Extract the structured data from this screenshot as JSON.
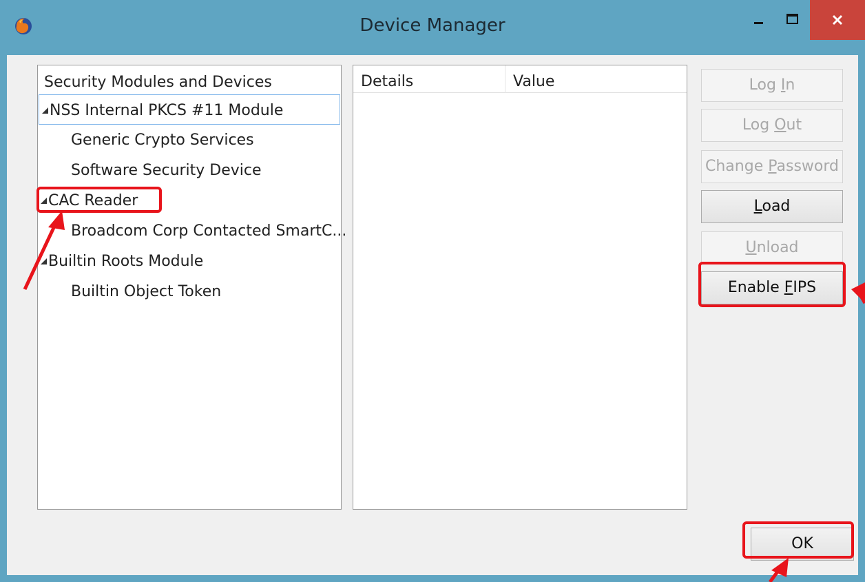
{
  "window": {
    "title": "Device Manager",
    "app_icon": "firefox-icon",
    "controls": {
      "minimize_icon": "minimize-icon",
      "maximize_icon": "maximize-icon",
      "close_icon": "close-icon"
    },
    "colors": {
      "titlebar": "#5fa5c2",
      "close": "#c9443b",
      "annotation": "#e8141b"
    }
  },
  "tree": {
    "header": "Security Modules and Devices",
    "items": [
      {
        "label": "NSS Internal PKCS #11 Module",
        "level": 0,
        "expanded": true,
        "selected": true
      },
      {
        "label": "Generic Crypto Services",
        "level": 1
      },
      {
        "label": "Software Security Device",
        "level": 1
      },
      {
        "label": "CAC Reader",
        "level": 0,
        "expanded": true,
        "highlighted": true
      },
      {
        "label": "Broadcom Corp Contacted SmartC...",
        "level": 1
      },
      {
        "label": "Builtin Roots Module",
        "level": 0,
        "expanded": true
      },
      {
        "label": "Builtin Object Token",
        "level": 1
      }
    ]
  },
  "details": {
    "columns": [
      "Details",
      "Value"
    ]
  },
  "buttons": {
    "log_in": {
      "pre": "Log ",
      "acc": "I",
      "post": "n",
      "enabled": false
    },
    "log_out": {
      "pre": "Log ",
      "acc": "O",
      "post": "ut",
      "enabled": false
    },
    "change_password": {
      "pre": "Change ",
      "acc": "P",
      "post": "assword",
      "enabled": false
    },
    "load": {
      "pre": "",
      "acc": "L",
      "post": "oad",
      "enabled": true
    },
    "unload": {
      "pre": "",
      "acc": "U",
      "post": "nload",
      "enabled": false
    },
    "enable_fips": {
      "pre": "Enable ",
      "acc": "F",
      "post": "IPS",
      "enabled": true,
      "highlighted": true
    },
    "ok": {
      "label": "OK",
      "highlighted": true
    }
  }
}
